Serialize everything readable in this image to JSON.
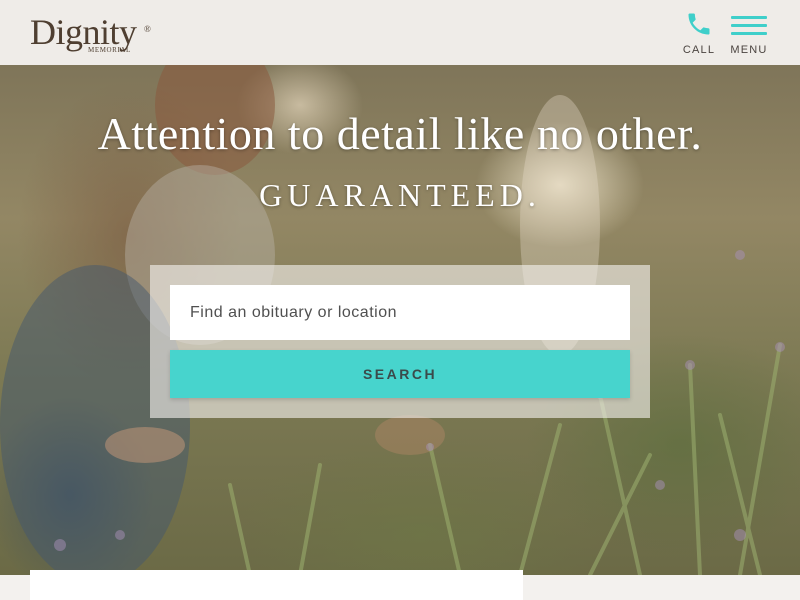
{
  "header": {
    "logo": {
      "name": "Dignity",
      "sub": "MEMORIAL",
      "reg": "®"
    },
    "call_label": "CALL",
    "menu_label": "MENU",
    "icons": {
      "call": "phone-icon",
      "menu": "hamburger-icon"
    }
  },
  "hero": {
    "headline": "Attention to detail like no other.",
    "subhead": "GUARANTEED."
  },
  "search": {
    "placeholder": "Find an obituary or location",
    "button_label": "SEARCH"
  },
  "colors": {
    "accent": "#47d4cd",
    "header_bg": "#efece8",
    "logo_text": "#4f3f31"
  }
}
